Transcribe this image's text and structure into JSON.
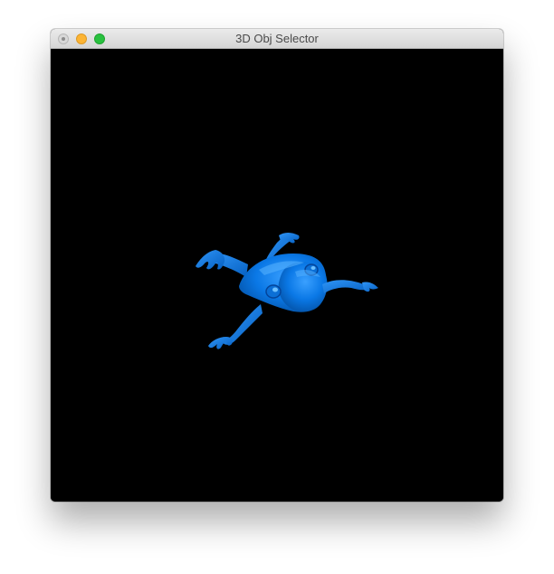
{
  "window": {
    "title": "3D Obj Selector"
  },
  "viewport": {
    "background_color": "#000000",
    "model": {
      "name": "frog",
      "color": "#0a78e6"
    }
  },
  "icons": {
    "close": "close-icon",
    "minimize": "minimize-icon",
    "zoom": "zoom-icon"
  }
}
